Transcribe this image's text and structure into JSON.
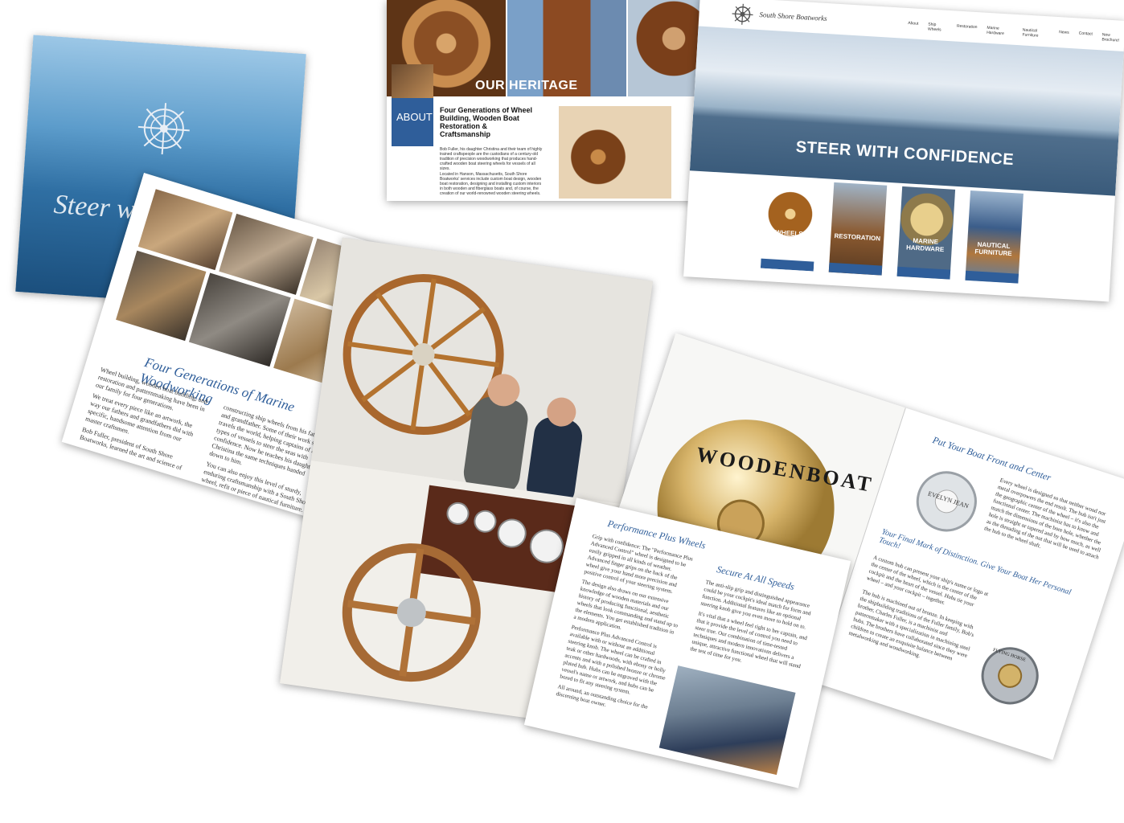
{
  "cover": {
    "tagline": "Steer with"
  },
  "woodworking_page": {
    "heading": "Four Generations of Marine Woodworking",
    "col1_para1": "Wheel building, wooden boat building, and restoration and patternmaking have been in our family for four generations.",
    "col1_para2": "We treat every piece like an artwork, the way our fathers and grandfathers did with specific, handsome attention from our master craftsmen.",
    "col1_para3": "Bob Fuller, president of South Shore Boatworks, learned the art and science of",
    "col2_para1": "constructing ship wheels from his father and grandfather. Some of their work still travels the world, helping captains of all types of vessels to steer the seas with confidence. Now he teaches his daughter Christina the same techniques handed down to him.",
    "col2_para2": "You can also enjoy this level of sturdy, enduring craftsmanship with a South Shore wheel, refit or piece of nautical furniture."
  },
  "heritage_site": {
    "banner": "OUR HERITAGE",
    "about_label": "ABOUT",
    "headline": "Four Generations of Wheel Building, Wooden Boat Restoration & Craftsmanship",
    "para1": "Bob Fuller, his daughter Christina and their team of highly trained craftspeople are the custodians of a century-old tradition of precision woodworking that produces hand-crafted wooden boat steering wheels for vessels of all sizes.",
    "para2": "Located in Hanson, Massachusetts, South Shore Boatworks' services include custom boat design, wooden boat restoration, designing and installing custom interiors in both wooden and fiberglass boats and, of course, the creation of our world-renowned wooden steering wheels."
  },
  "steer_site": {
    "brand": "South Shore Boatworks",
    "nav": [
      "About",
      "Ship Wheels",
      "Restoration",
      "Marine Hardware",
      "Nautical Furniture",
      "News",
      "Contact",
      "New Brochure!"
    ],
    "hero_title": "STEER WITH CONFIDENCE",
    "tiles": [
      "WHEELS",
      "RESTORATION",
      "MARINE HARDWARE",
      "NAUTICAL FURNITURE"
    ]
  },
  "spread": {
    "medallion_text": "WOODENBOAT",
    "right_title": "Put Your Boat Front and Center",
    "right_para": "Every wheel is designed so that neither wood nor metal overpowers the end result. The hub isn't just the geographic center of the wheel – it's also the functional center. The machinist has to know and match the dimensions of the bore hole, whether the hole is straight or tapered and by how much, as well as the threading of the nut that will be used to attach the hub to the wheel shaft.",
    "sub_title": "Your Final Mark of Distinction. Give Your Boat Her Personal Touch!",
    "sub_para1": "A custom hub can present your ship's name or logo at the center of the wheel, which is the center of the cockpit and the heart of the vessel. Hubs tie your wheel – and your cockpit – together.",
    "sub_para2": "The hub is machined out of bronze. In keeping with the shipbuilding traditions of the Fuller family, Bob's brother, Charles Fuller, is a machinist and patternmaker with a specialization in machining steel hubs. The brothers have collaborated since they were children to create an exquisite balance between metalworking and woodworking.",
    "hub1_text": "EVELYN JEAN",
    "hub2_text": "FLYING HORSE"
  },
  "performance": {
    "title": "Performance Plus Wheels",
    "para1": "Grip with confidence: The \"Performance Plus Advanced Control\" wheel is designed to be easily gripped in all kinds of weather. Advanced finger grips on the back of the wheel give your hand more precision and positive control of your steering system.",
    "para2": "The design also draws on our extensive knowledge of wooden materials and our history of producing functional, aesthetic wheels that look commanding and stand up to the elements. You get established tradition in a modern application.",
    "para3": "Performance Plus Advanced Control is available with or without an additional steering knob. The wheel can be crafted in teak or other hardwoods, with ebony or holly accents and with a polished bronze or chrome plated hub. Hubs can be engraved with the vessel's name or artwork, and hubs can be bored to fit any steering system.",
    "para4": "All around, an outstanding choice for the discerning boat owner.",
    "title2": "Secure At All Speeds",
    "para5": "The anti-slip grip and distinguished appearance could be your cockpit's ideal match for form and function. Additional features like an optional steering knob give you even more to hold on to.",
    "para6": "It's vital that a wheel feel right to her captain, and that it provide the level of control you need to steer true. Our combination of time-tested techniques and modern innovations delivers a unique, attractive functional wheel that will stand the test of time for you."
  },
  "colors": {
    "accent_blue": "#2f5e9a",
    "wood": "#a8622a",
    "brass": "#d7b46a"
  }
}
